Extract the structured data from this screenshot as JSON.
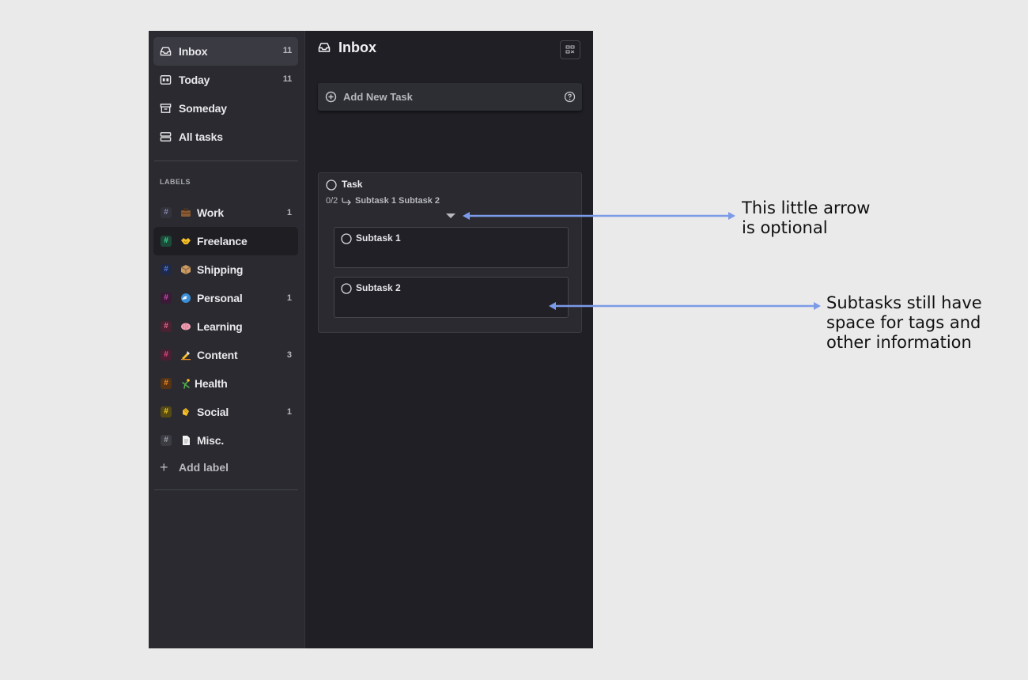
{
  "sidebar": {
    "nav": [
      {
        "label": "Inbox",
        "count": "11",
        "icon": "inbox-icon"
      },
      {
        "label": "Today",
        "count": "11",
        "icon": "calendar-icon"
      },
      {
        "label": "Someday",
        "count": "",
        "icon": "archive-icon"
      },
      {
        "label": "All tasks",
        "count": "",
        "icon": "stack-icon"
      }
    ],
    "section_label": "LABELS",
    "labels": [
      {
        "name": "Work",
        "count": "1",
        "hash_color": "#3c3c48",
        "hash_text": "#8a8ab0",
        "emoji": "briefcase"
      },
      {
        "name": "Freelance",
        "count": "",
        "hash_color": "#1c4a38",
        "hash_text": "#3fd58f",
        "emoji": "handshake"
      },
      {
        "name": "Shipping",
        "count": "",
        "hash_color": "#202a48",
        "hash_text": "#4f7fe8",
        "emoji": "package"
      },
      {
        "name": "Personal",
        "count": "1",
        "hash_color": "#3a1a36",
        "hash_text": "#c94fb0",
        "emoji": "wave"
      },
      {
        "name": "Learning",
        "count": "",
        "hash_color": "#4a2231",
        "hash_text": "#e86a90",
        "emoji": "brain"
      },
      {
        "name": "Content",
        "count": "3",
        "hash_color": "#4a1f33",
        "hash_text": "#e24d85",
        "emoji": "writing-hand"
      },
      {
        "name": "Health",
        "count": "",
        "hash_color": "#553416",
        "hash_text": "#f08a26",
        "emoji": "cartwheel"
      },
      {
        "name": "Social",
        "count": "1",
        "hash_color": "#564a14",
        "hash_text": "#f2cc22",
        "emoji": "clapping"
      },
      {
        "name": "Misc.",
        "count": "",
        "hash_color": "#3c3c44",
        "hash_text": "#a0a0aa",
        "emoji": "page"
      }
    ],
    "add_label": "Add label"
  },
  "main": {
    "title": "Inbox",
    "add_task_placeholder": "Add New Task",
    "task": {
      "title": "Task",
      "progress": "0/2",
      "subtask_list": "Subtask 1 Subtask 2",
      "subtasks": [
        {
          "title": "Subtask 1"
        },
        {
          "title": "Subtask 2"
        }
      ]
    }
  },
  "annotations": {
    "arrow_note": [
      "This little arrow",
      "is optional"
    ],
    "subtask_note": [
      "Subtasks still have",
      "space for tags and",
      "other information"
    ],
    "arrow_color": "#7b9be8"
  }
}
